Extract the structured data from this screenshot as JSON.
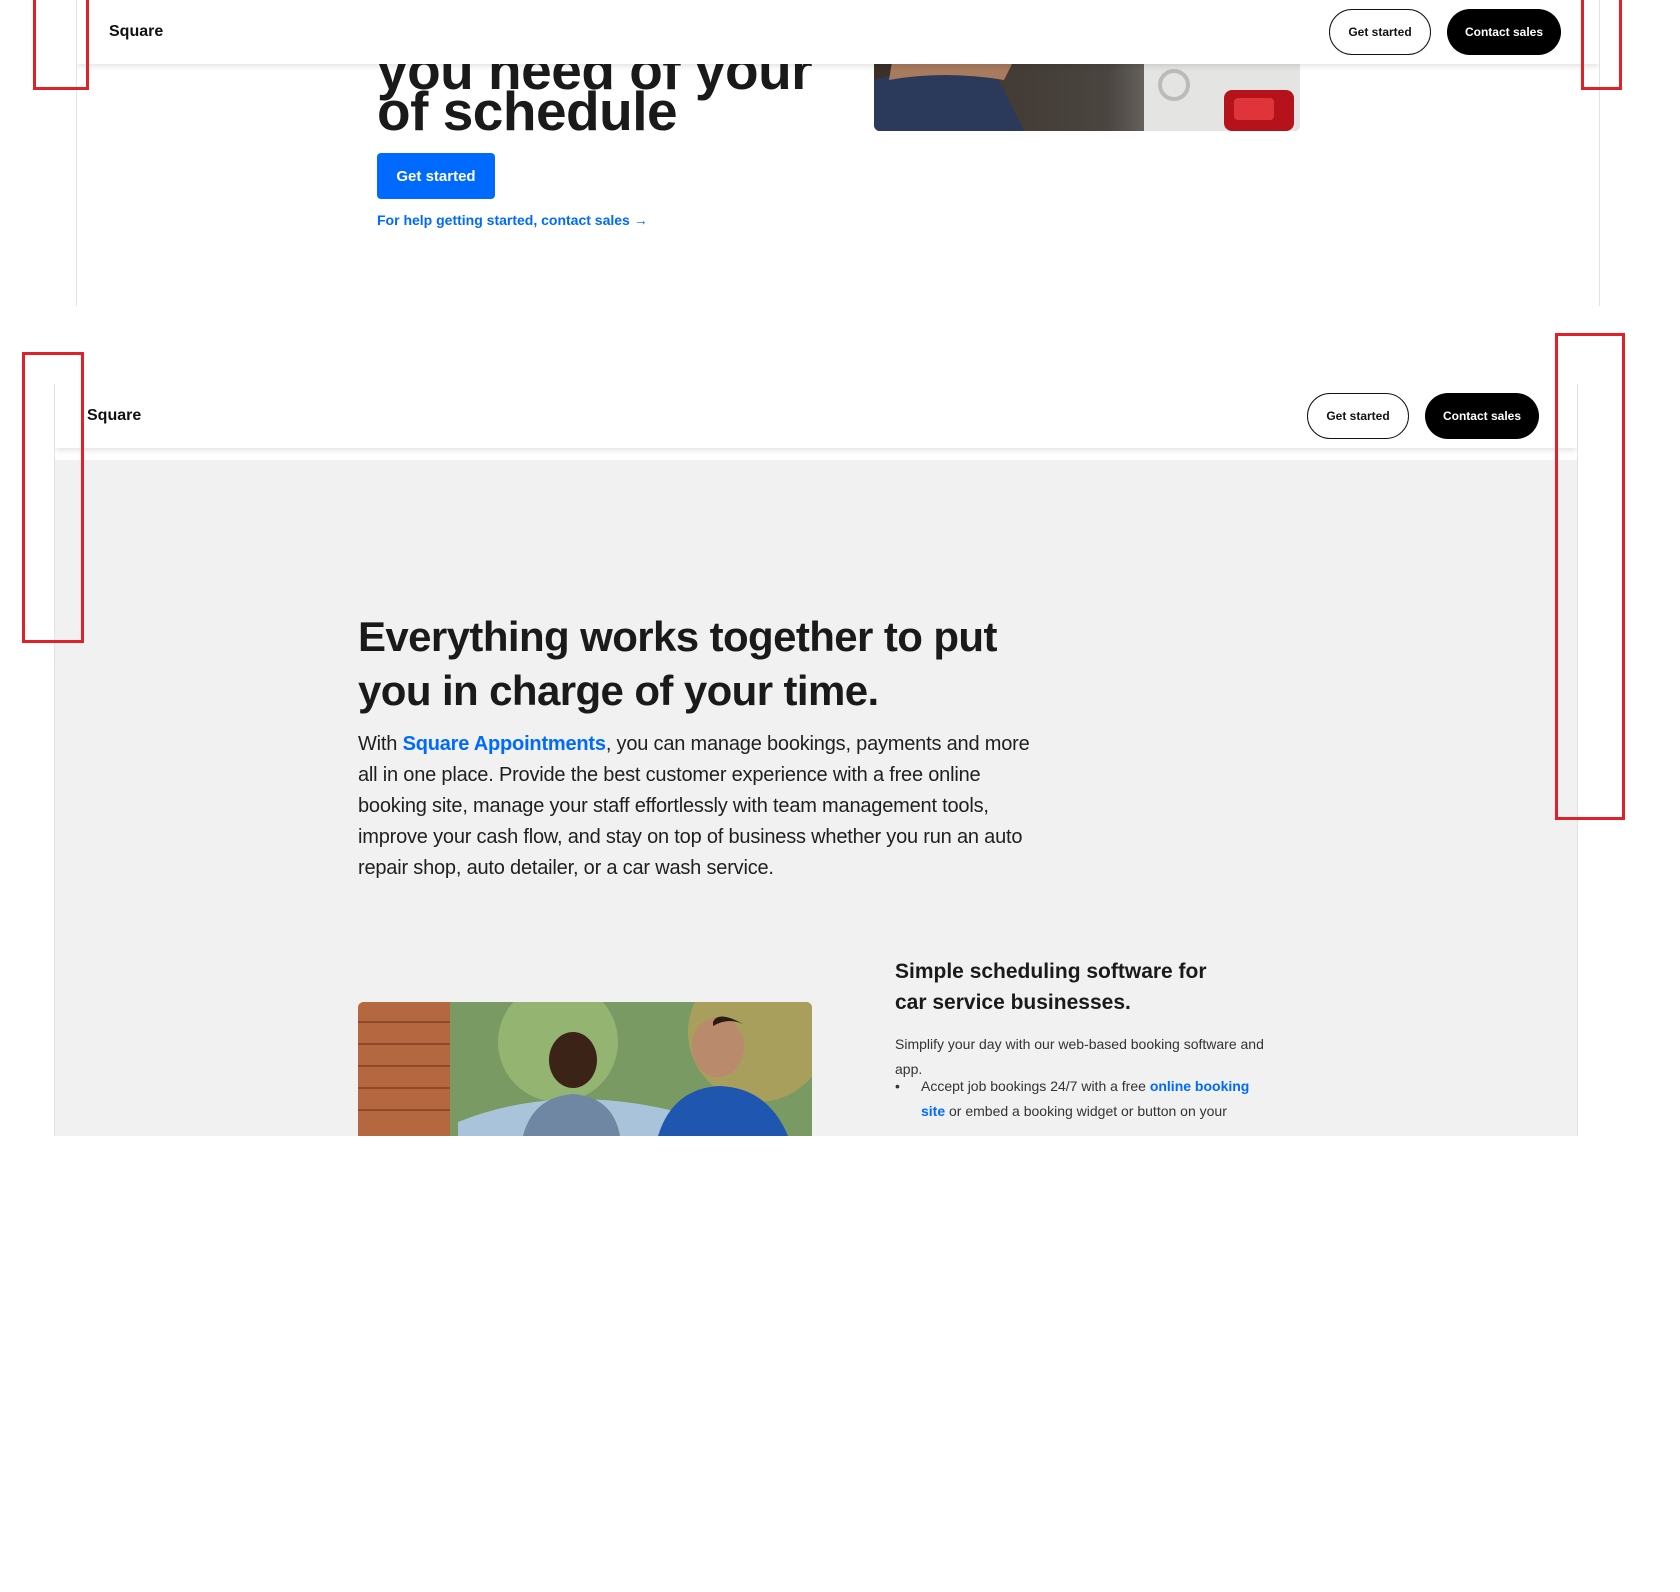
{
  "top_frame": {
    "nav": {
      "brand": "Square",
      "get_started": "Get started",
      "contact_sales": "Contact sales"
    },
    "hero": {
      "cut_line": "you need of your",
      "line2": "of schedule",
      "cta": "Get started",
      "help_link": "For help getting started, contact sales →"
    }
  },
  "bottom_frame": {
    "nav": {
      "brand": "Square",
      "get_started": "Get started",
      "contact_sales": "Contact sales"
    },
    "section": {
      "title": "Everything works together to put you in charge of your time.",
      "body_pre": "With ",
      "body_link": "Square Appointments",
      "body_post": ", you can manage bookings, payments and more all in one place. Provide the best customer experience with a free online booking site, manage your staff effortlessly with team management tools, improve your cash flow, and stay on top of business whether you run an auto repair shop, auto detailer, or a car wash service."
    },
    "feature": {
      "title": "Simple scheduling software for car service businesses.",
      "body": "Simplify your day with our web-based booking software and app.",
      "bullet_pre": "Accept job bookings 24/7 with a free ",
      "bullet_link": "online booking site",
      "bullet_post": " or embed a booking widget or button on your"
    }
  },
  "colors": {
    "accent": "#006aff",
    "annotation": "#e0212a",
    "section_bg": "#f1f1f1"
  }
}
